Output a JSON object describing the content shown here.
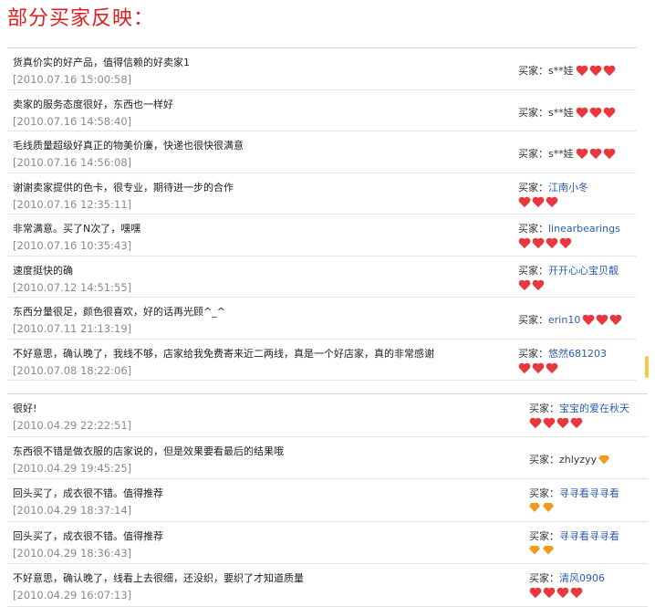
{
  "title": "部分买家反映：",
  "buyer_prefix": "买家：",
  "section1": [
    {
      "comment": "货真价实的好产品，值得信赖的好卖家1",
      "date": "[2010.07.16 15:00:58]",
      "buyer": "s**娃",
      "link": false,
      "hearts": 3,
      "diamonds": 0,
      "two_line": false
    },
    {
      "comment": "卖家的服务态度很好，东西也一样好",
      "date": "[2010.07.16 14:58:40]",
      "buyer": "s**娃",
      "link": false,
      "hearts": 3,
      "diamonds": 0,
      "two_line": false
    },
    {
      "comment": "毛线质量超级好真正的物美价廉，快递也很快很满意",
      "date": "[2010.07.16 14:56:08]",
      "buyer": "s**娃",
      "link": false,
      "hearts": 3,
      "diamonds": 0,
      "two_line": false
    },
    {
      "comment": "谢谢卖家提供的色卡，很专业，期待进一步的合作",
      "date": "[2010.07.16 12:35:11]",
      "buyer": "江南小冬",
      "link": true,
      "hearts": 3,
      "diamonds": 0,
      "two_line": true
    },
    {
      "comment": "非常满意。买了N次了，嘿嘿",
      "date": "[2010.07.16 10:35:43]",
      "buyer": "linearbearings",
      "link": true,
      "hearts": 4,
      "diamonds": 0,
      "two_line": true
    },
    {
      "comment": "速度挺快的确",
      "date": "[2010.07.12 14:51:55]",
      "buyer": "开开心心宝贝靓",
      "link": true,
      "hearts": 2,
      "diamonds": 0,
      "two_line": true
    },
    {
      "comment": "东西分量很足，颜色很喜欢，好的话再光顾^_^",
      "date": "[2010.07.11 21:13:19]",
      "buyer": "erin10",
      "link": true,
      "hearts": 3,
      "diamonds": 0,
      "two_line": false
    },
    {
      "comment": "不好意思，确认晚了，我线不够，店家给我免费寄来近二两线，真是一个好店家，真的非常感谢",
      "date": "[2010.07.08 18:22:06]",
      "buyer": "悠然681203",
      "link": true,
      "hearts": 3,
      "diamonds": 0,
      "two_line": true
    }
  ],
  "section2": [
    {
      "comment": "很好!",
      "date": "[2010.04.29 22:22:51]",
      "buyer": "宝宝的爱在秋天",
      "link": true,
      "hearts": 4,
      "diamonds": 0,
      "two_line": true
    },
    {
      "comment": "东西很不错是做衣服的店家说的，但是效果要看最后的结果哦",
      "date": "[2010.04.29 19:45:25]",
      "buyer": "zhlyzyy",
      "link": false,
      "hearts": 0,
      "diamonds": 1,
      "two_line": false
    },
    {
      "comment": "回头买了，成衣很不错。值得推荐",
      "date": "[2010.04.29 18:37:14]",
      "buyer": "寻寻看寻寻看",
      "link": true,
      "hearts": 0,
      "diamonds": 2,
      "two_line": true
    },
    {
      "comment": "回头买了，成衣很不错。值得推荐",
      "date": "[2010.04.29 18:36:43]",
      "buyer": "寻寻看寻寻看",
      "link": true,
      "hearts": 0,
      "diamonds": 2,
      "two_line": true
    },
    {
      "comment": "不好意思，确认晚了，线看上去很细，还没织，要织了才知道质量",
      "date": "[2010.04.29 16:07:13]",
      "buyer": "清风0906",
      "link": true,
      "hearts": 4,
      "diamonds": 0,
      "two_line": true
    }
  ]
}
